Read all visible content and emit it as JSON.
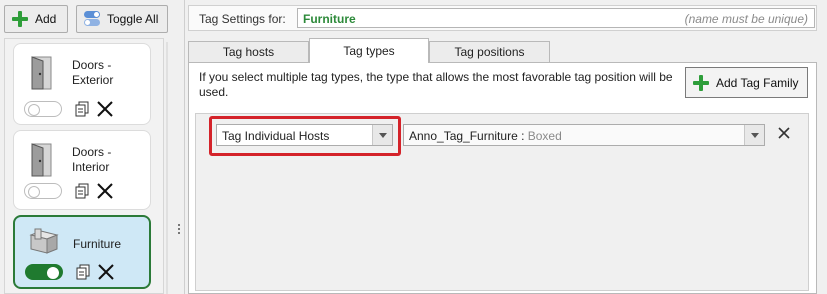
{
  "toolbar": {
    "add_label": "Add",
    "toggle_all_label": "Toggle All"
  },
  "families": [
    {
      "label": "Doors -\nExterior",
      "icon": "door-icon",
      "enabled": false,
      "selected": false
    },
    {
      "label": "Doors -\nInterior",
      "icon": "door-icon",
      "enabled": false,
      "selected": false
    },
    {
      "label": "Furniture",
      "icon": "furniture-cube-icon",
      "enabled": true,
      "selected": true
    }
  ],
  "settings": {
    "label": "Tag Settings for:",
    "name_value": "Furniture",
    "name_hint": "(name must be unique)"
  },
  "tabs": [
    {
      "label": "Tag hosts",
      "active": false
    },
    {
      "label": "Tag types",
      "active": true
    },
    {
      "label": "Tag positions",
      "active": false
    }
  ],
  "tag_types": {
    "info": "If you select multiple tag types, the type that allows the most favorable tag position will be used.",
    "add_family_label": "Add Tag Family",
    "host_mode": "Tag Individual Hosts",
    "tag_family": "Anno_Tag_Furniture :",
    "tag_type": "Boxed"
  },
  "colors": {
    "accent_green": "#2d8a3a",
    "toggle_on": "#1f7a2f",
    "selected_card_bg": "#cfe8f6",
    "highlight_red": "#d4232a"
  }
}
